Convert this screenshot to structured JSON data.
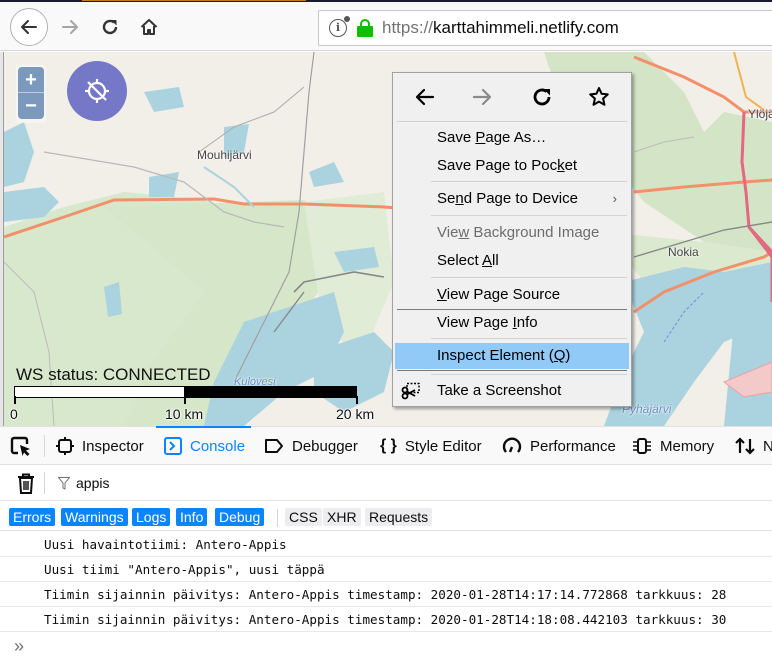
{
  "browser": {
    "url_scheme": "https://",
    "url_host": "karttahimmeli.netlify.com",
    "nav_icons": [
      "back-arrow-icon",
      "forward-arrow-icon",
      "reload-icon",
      "home-icon"
    ],
    "url_icons": [
      "page-info-icon",
      "secure-lock-icon"
    ]
  },
  "map": {
    "zoom_in_label": "+",
    "zoom_out_label": "−",
    "locate_icon": "location-disabled-icon",
    "labels": {
      "mouhijarvi": "Mouhijärvi",
      "nokia": "Nokia",
      "ylojarvi": "Ylöjä",
      "kulovesi": "Kulovesi",
      "pyhajarvi": "Pyhäjärvi"
    },
    "ws_status": "WS status: CONNECTED",
    "scale": {
      "zero": "0",
      "mid": "10 km",
      "end": "20 km"
    }
  },
  "context_menu": {
    "nav_icons": [
      "back-icon",
      "forward-icon",
      "reload-icon",
      "bookmark-star-icon"
    ],
    "items": [
      {
        "pre": "Save ",
        "key": "P",
        "post": "age As…",
        "disabled": false
      },
      {
        "pre": "Save Page to Poc",
        "key": "k",
        "post": "et",
        "disabled": false
      },
      {
        "pre": "Se",
        "key": "n",
        "post": "d Page to Device",
        "disabled": false,
        "submenu": "›"
      },
      {
        "pre": "Vie",
        "key": "w",
        "post": " Background Image",
        "disabled": true
      },
      {
        "pre": "Select ",
        "key": "A",
        "post": "ll",
        "disabled": false
      },
      {
        "pre": "",
        "key": "V",
        "post": "iew Page Source",
        "disabled": false
      },
      {
        "pre": "View Page ",
        "key": "I",
        "post": "nfo",
        "disabled": false
      },
      {
        "pre": "Inspect Element (",
        "key": "Q",
        "post": ")",
        "disabled": false,
        "highlighted": true
      },
      {
        "pre": "Take a Screenshot",
        "key": "",
        "post": "",
        "disabled": false,
        "icon": "screenshot-scissors-icon"
      }
    ]
  },
  "devtools": {
    "tabs": [
      {
        "label": "Inspector",
        "icon": "inspector-icon"
      },
      {
        "label": "Console",
        "icon": "console-icon",
        "active": true
      },
      {
        "label": "Debugger",
        "icon": "debugger-icon"
      },
      {
        "label": "Style Editor",
        "icon": "style-editor-icon"
      },
      {
        "label": "Performance",
        "icon": "performance-icon"
      },
      {
        "label": "Memory",
        "icon": "memory-icon"
      },
      {
        "label": "N",
        "icon": "network-icon"
      }
    ],
    "filter_value": "appis",
    "levels_on": [
      "Errors",
      "Warnings",
      "Logs",
      "Info",
      "Debug"
    ],
    "levels_off": [
      "CSS",
      "XHR",
      "Requests"
    ],
    "logs": [
      "Uusi havaintotiimi: Antero-Appis",
      "Uusi tiimi \"Antero-Appis\", uusi täppä",
      "Tiimin sijainnin päivitys: Antero-Appis timestamp: 2020-01-28T14:17:14.772868 tarkkuus: 28",
      "Tiimin sijainnin päivitys: Antero-Appis timestamp: 2020-01-28T14:18:08.442103 tarkkuus: 30"
    ],
    "prompt": "»"
  }
}
